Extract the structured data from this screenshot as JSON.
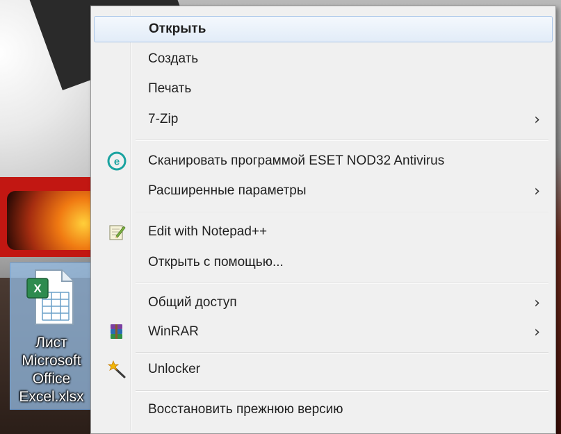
{
  "desktop": {
    "file_icon": {
      "name": "xlsx-file-icon",
      "label_lines": "Лист\nMicrosoft\nOffice\nExcel.xlsx"
    }
  },
  "context_menu": {
    "items": [
      {
        "label": "Открыть",
        "bold": true,
        "highlighted": true
      },
      {
        "label": "Создать"
      },
      {
        "label": "Печать"
      },
      {
        "label": "7-Zip",
        "submenu": true
      },
      {
        "label": "Сканировать программой ESET NOD32 Antivirus",
        "icon": "eset-icon"
      },
      {
        "label": "Расширенные параметры",
        "submenu": true
      },
      {
        "label": "Edit with Notepad++",
        "icon": "notepad-plus-plus-icon"
      },
      {
        "label": "Открыть с помощью..."
      },
      {
        "label": "Общий доступ",
        "submenu": true
      },
      {
        "label": "WinRAR",
        "icon": "winrar-icon",
        "submenu": true
      },
      {
        "label": "Unlocker",
        "icon": "unlocker-wand-icon"
      },
      {
        "label": "Восстановить прежнюю версию"
      }
    ],
    "submenu_glyph": "›"
  },
  "colors": {
    "menu_background": "#f0f0f0",
    "highlight": "#e2ecf8",
    "highlight_border": "#a9c5e8",
    "eset_teal": "#1aa3a0",
    "excel_green": "#207245"
  }
}
